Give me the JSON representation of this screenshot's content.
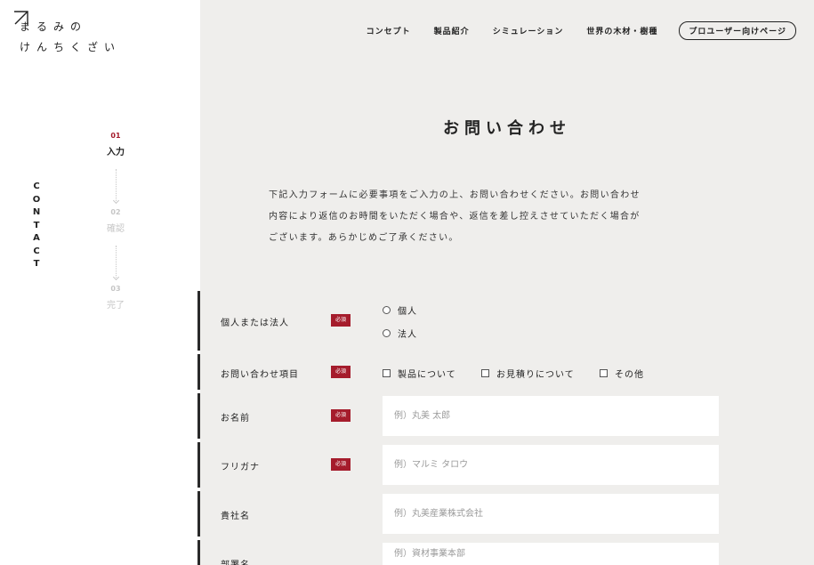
{
  "logo": {
    "line1": "まるみの",
    "line2": "けんちくざい"
  },
  "sidebar": {
    "vertical_label": [
      "C",
      "O",
      "N",
      "T",
      "A",
      "C",
      "T"
    ],
    "steps": [
      {
        "num": "01",
        "label": "入力",
        "state": "active"
      },
      {
        "num": "02",
        "label": "確認",
        "state": "inactive"
      },
      {
        "num": "03",
        "label": "完了",
        "state": "inactive"
      }
    ]
  },
  "nav": {
    "links": [
      "コンセプト",
      "製品紹介",
      "シミュレーション",
      "世界の木材・樹種"
    ],
    "pro_button": "プロユーザー向けページ"
  },
  "page_title": "お問い合わせ",
  "intro_lines": [
    "下記入力フォームに必要事項をご入力の上、お問い合わせください。お問い合わせ",
    "内容により返信のお時間をいただく場合や、返信を差し控えさせていただく場合が",
    "ございます。あらかじめご了承ください。"
  ],
  "required_badge": "必須",
  "form": {
    "type": {
      "label": "個人または法人",
      "options": [
        "個人",
        "法人"
      ]
    },
    "inquiry": {
      "label": "お問い合わせ項目",
      "options": [
        "製品について",
        "お見積りについて",
        "その他"
      ]
    },
    "name": {
      "label": "お名前",
      "placeholder": "例）丸美 太郎"
    },
    "kana": {
      "label": "フリガナ",
      "placeholder": "例）マルミ タロウ"
    },
    "company": {
      "label": "貴社名",
      "placeholder": "例）丸美産業株式会社"
    },
    "department": {
      "label": "部署名",
      "placeholder": "例）資材事業本部"
    }
  },
  "colors": {
    "accent": "#a51c2c",
    "main_bg": "#efeeec",
    "row_bar": "#2a2a2a"
  }
}
